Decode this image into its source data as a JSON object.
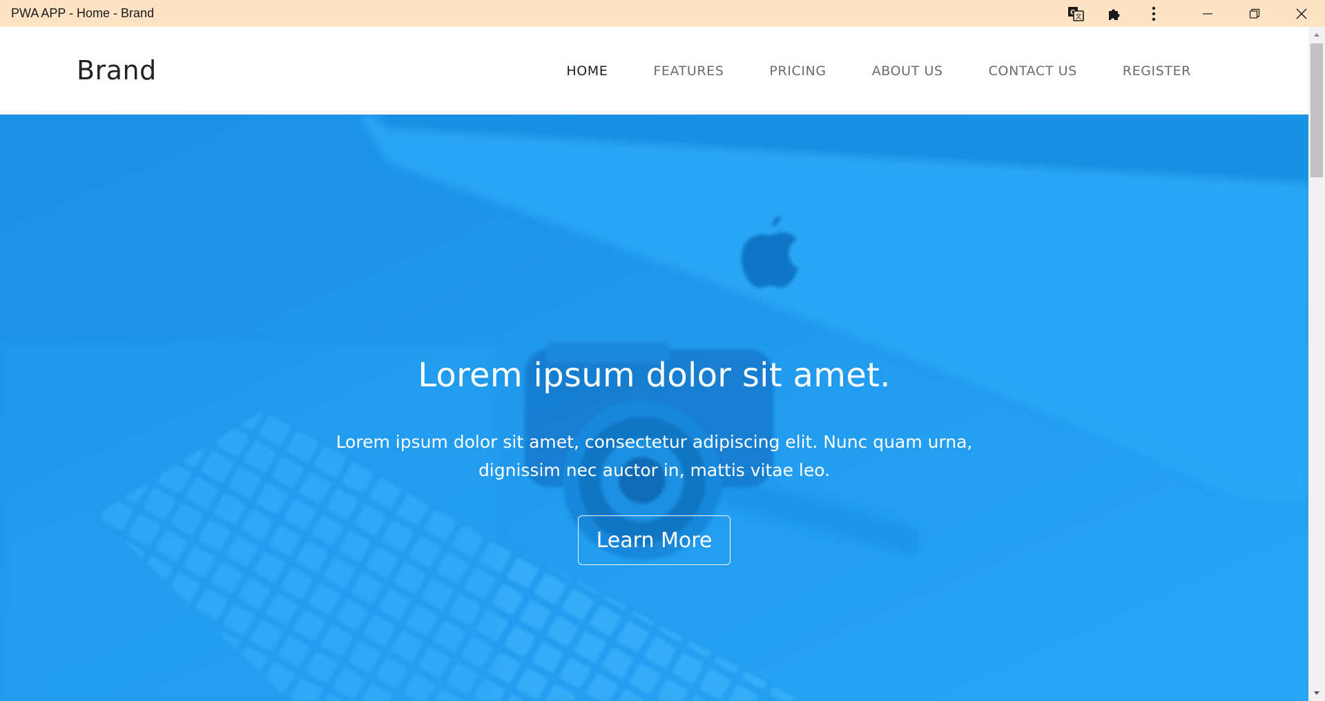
{
  "window": {
    "title": "PWA APP - Home - Brand",
    "titlebar_color": "#fde2c3",
    "buttons": [
      "translate-icon",
      "extensions-icon",
      "more-icon",
      "minimize-icon",
      "restore-icon",
      "close-icon"
    ]
  },
  "navbar": {
    "brand": "Brand",
    "links": [
      {
        "label": "HOME",
        "active": true
      },
      {
        "label": "FEATURES",
        "active": false
      },
      {
        "label": "PRICING",
        "active": false
      },
      {
        "label": "ABOUT US",
        "active": false
      },
      {
        "label": "CONTACT US",
        "active": false
      },
      {
        "label": "REGISTER",
        "active": false
      }
    ]
  },
  "hero": {
    "title": "Lorem ipsum dolor sit amet.",
    "text": "Lorem ipsum dolor sit amet, consectetur adipiscing elit. Nunc quam urna, dignissim nec auctor in, mattis vitae leo.",
    "button_label": "Learn More",
    "background_color": "#1f9cf0"
  },
  "colors": {
    "accent": "#1f9cf0",
    "nav_active": "#1c1c1c",
    "nav_inactive": "#6b6b6b"
  }
}
